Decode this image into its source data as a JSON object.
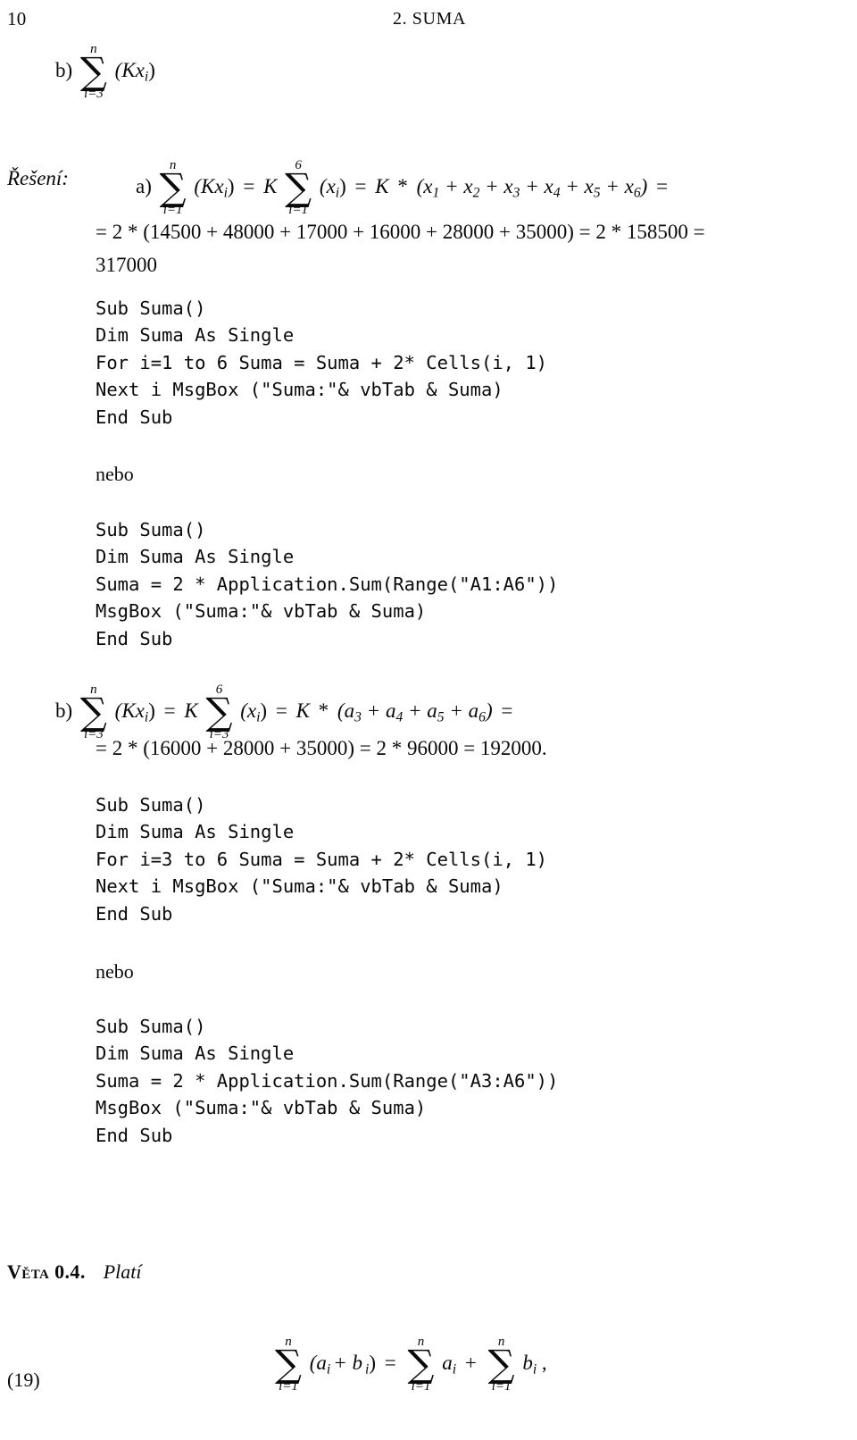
{
  "page": {
    "folio": "10",
    "running_head": "2. SUMA"
  },
  "problem_b_heading": {
    "marker": "b)",
    "sum_upper": "n",
    "sum_lower": "i=3",
    "body": "(Kx",
    "body_sub": "i",
    "body_close": ")"
  },
  "solution": {
    "label": "Řešení:",
    "part_a": {
      "marker": "a)",
      "line1": {
        "sum1_upper": "n",
        "sum1_lower": "i=1",
        "term1": "(Kx",
        "term1_sub": "i",
        "term1_close": ")",
        "eq1": "=",
        "K1": "K",
        "sum2_upper": "6",
        "sum2_lower": "i=1",
        "term2": "(x",
        "term2_sub": "i",
        "term2_close": ")",
        "eq2": "=",
        "K2": "K",
        "star": "*",
        "expansion": "(x1 + x2 + x3 + x4 + x5 + x6)",
        "trailing_eq": "="
      },
      "line2": "= 2 * (14500 + 48000 + 17000 + 16000 + 28000 + 35000) = 2 * 158500 =",
      "line3": "317000"
    },
    "part_b": {
      "marker": "b)",
      "sum1_upper": "n",
      "sum1_lower": "i=3",
      "term1": "(Kx",
      "term1_sub": "i",
      "term1_close": ")",
      "eq1": "=",
      "K1": "K",
      "sum2_upper": "6",
      "sum2_lower": "i=3",
      "term2": "(x",
      "term2_sub": "i",
      "term2_close": ")",
      "eq2": "=",
      "K2": "K",
      "star": "*",
      "expansion": "(a3 + a4 + a5 + a6)",
      "trailing_eq": "=",
      "line2": "= 2 * (16000 + 28000 + 35000) = 2 * 96000 = 192000."
    }
  },
  "alt_word_1": "nebo",
  "alt_word_2": "nebo",
  "code_blocks": {
    "a_loop": "Sub Suma()\nDim Suma As Single\nFor i=1 to 6 Suma = Suma + 2* Cells(i, 1)\nNext i MsgBox (\"Suma:\"& vbTab & Suma)\nEnd Sub",
    "a_worksheet": "Sub Suma()\nDim Suma As Single\nSuma = 2 * Application.Sum(Range(\"A1:A6\"))\nMsgBox (\"Suma:\"& vbTab & Suma)\nEnd Sub",
    "b_loop": "Sub Suma()\nDim Suma As Single\nFor i=3 to 6 Suma = Suma + 2* Cells(i, 1)\nNext i MsgBox (\"Suma:\"& vbTab & Suma)\nEnd Sub",
    "b_worksheet": "Sub Suma()\nDim Suma As Single\nSuma = 2 * Application.Sum(Range(\"A3:A6\"))\nMsgBox (\"Suma:\"& vbTab & Suma)\nEnd Sub"
  },
  "theorem": {
    "name": "Věta 0.4.",
    "body": "Platí"
  },
  "equation_19": {
    "number": "(19)",
    "sum1_upper": "n",
    "sum1_lower": "i=1",
    "term1_open": "(a",
    "term1_sub1": "i",
    "term1_plus": "+ b",
    "term1_sub2": "i",
    "term1_close": ")",
    "eq": "=",
    "sum2_upper": "n",
    "sum2_lower": "i=1",
    "term2": "a",
    "term2_sub": "i",
    "plus": "+",
    "sum3_upper": "n",
    "sum3_lower": "i=1",
    "term3": "b",
    "term3_sub": "i",
    "comma": ","
  }
}
